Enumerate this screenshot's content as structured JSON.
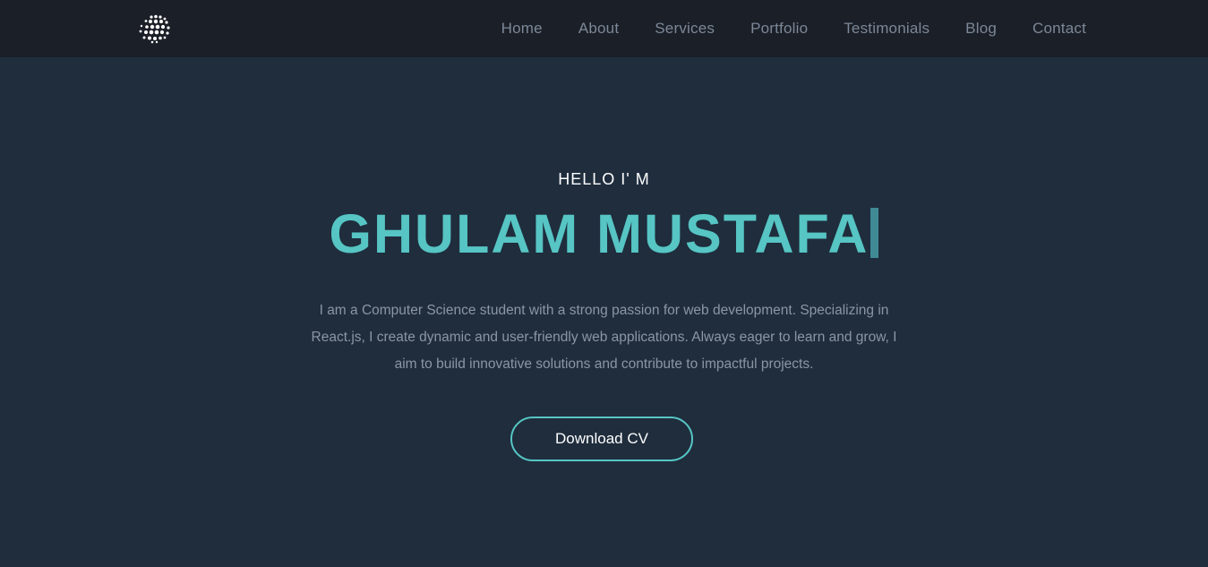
{
  "nav": {
    "logo_icon": "dotted-sphere-logo-icon",
    "items": [
      {
        "label": "Home"
      },
      {
        "label": "About"
      },
      {
        "label": "Services"
      },
      {
        "label": "Portfolio"
      },
      {
        "label": "Testimonials"
      },
      {
        "label": "Blog"
      },
      {
        "label": "Contact"
      }
    ]
  },
  "hero": {
    "greeting": "HELLO I' M",
    "name": "GHULAM MUSTAFA",
    "description": "I am a Computer Science student with a strong passion for web development. Specializing in React.js, I create dynamic and user-friendly web applications. Always eager to learn and grow, I aim to build innovative solutions and contribute to impactful projects.",
    "cta_label": "Download CV"
  },
  "colors": {
    "nav_background": "#1b1f27",
    "page_background": "#1f2d3d",
    "accent": "#56c5c4",
    "cursor": "#3f8a95",
    "nav_link": "#7c8898",
    "body_text": "#8b96a3"
  }
}
